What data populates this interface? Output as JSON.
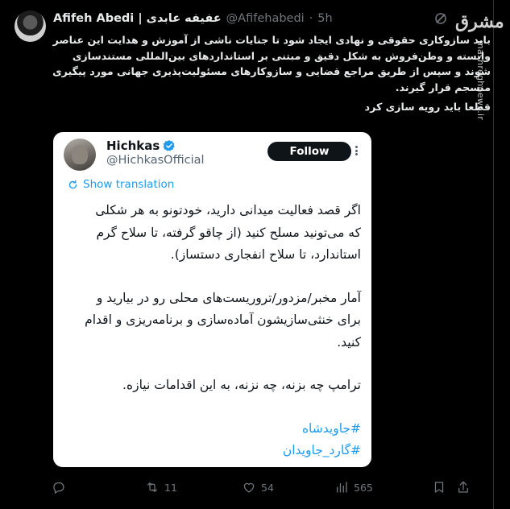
{
  "tweet": {
    "author_name": "Afifeh Abedi | عفیفه عابدی",
    "author_handle": "@Afifehabedi",
    "separator": "·",
    "time": "5h",
    "text_lines": [
      "باید سازوکاری حقوقی و نهادی ایجاد شود تا جنایات ناشی از آموزش و هدایت این عناصر",
      "وابسته و وطن‌فروش به شکل دقیق و مبتنی بر استانداردهای بین‌المللی مستندسازی",
      "شوند و سپس از طریق مراجع قضایی و سازوکارهای مسئولیت‌پذیری جهانی مورد پیگیری",
      "منسجم قرار گیرند."
    ],
    "text_last": "قطعا باید رویه سازی کرد"
  },
  "watermark": {
    "logo": "مشرق",
    "url": "mashreghnews.ir"
  },
  "quoted": {
    "name": "Hichkas",
    "handle": "@HichkasOfficial",
    "follow_label": "Follow",
    "show_translation": "Show translation",
    "para1": [
      "اگر قصد فعالیت میدانی دارید، خودتونو به هر شکلی",
      "که می‌تونید مسلح کنید (از چاقو گرفته، تا سلاح گرم",
      "استاندارد، تا سلاح انفجاری دستساز)."
    ],
    "para2": [
      "آمار مخبر/مزدور/تروریست‌های محلی رو در بیارید و",
      "برای خنثی‌سازیشون آماده‌سازی و برنامه‌ریزی و اقدام",
      "کنید."
    ],
    "para3": "ترامپ چه بزنه، چه نزنه، به این اقدامات نیازه.",
    "hashtags": [
      "#جاویدشاه",
      "#گارد_جاویدان"
    ]
  },
  "actions": {
    "replies": "",
    "retweets": "11",
    "likes": "54",
    "views": "565"
  },
  "colors": {
    "background": "#000000",
    "accent": "#1d9bf0",
    "muted": "#71767b",
    "card_bg": "#ffffff"
  },
  "icons": [
    "grok-icon",
    "verified-icon",
    "translate-icon",
    "reply-icon",
    "retweet-icon",
    "like-icon",
    "views-icon",
    "bookmark-icon",
    "share-icon",
    "more-icon"
  ]
}
